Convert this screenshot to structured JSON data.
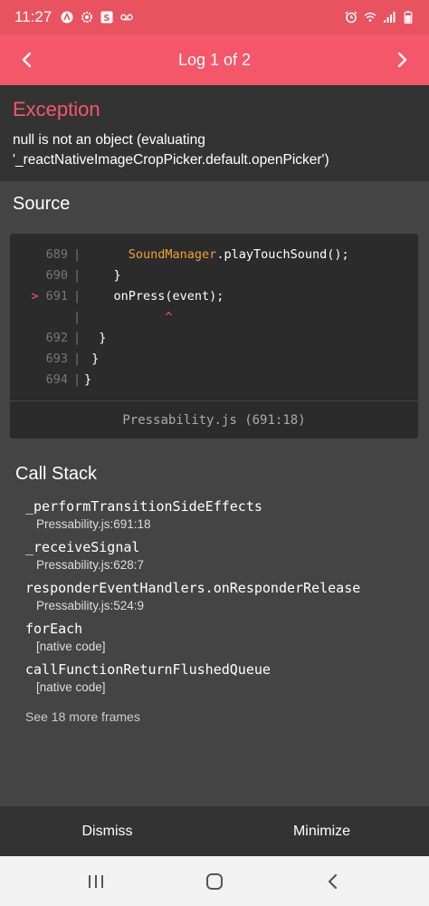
{
  "status_bar": {
    "time": "11:27",
    "left_icons": [
      "app-icon-a",
      "settings-cog-icon",
      "app-icon-s",
      "voicemail-icon"
    ],
    "right_icons": [
      "alarm-icon",
      "wifi-icon",
      "signal-icon",
      "battery-icon"
    ]
  },
  "header": {
    "title": "Log 1 of 2"
  },
  "exception": {
    "title": "Exception",
    "message": "null is not an object (evaluating '_reactNativeImageCropPicker.default.openPicker')"
  },
  "source": {
    "title": "Source",
    "lines": [
      {
        "num": "689",
        "marker": "",
        "pre": "      ",
        "hl": "SoundManager",
        "post": ".playTouchSound();"
      },
      {
        "num": "690",
        "marker": "",
        "pre": "    }",
        "hl": "",
        "post": ""
      },
      {
        "num": "691",
        "marker": ">",
        "pre": "    onPress(event);",
        "hl": "",
        "post": ""
      },
      {
        "num": "",
        "marker": "",
        "pre": "           ",
        "hl": "",
        "post": "",
        "caret": "^"
      },
      {
        "num": "692",
        "marker": "",
        "pre": "  }",
        "hl": "",
        "post": ""
      },
      {
        "num": "693",
        "marker": "",
        "pre": " }",
        "hl": "",
        "post": ""
      },
      {
        "num": "694",
        "marker": "",
        "pre": "}",
        "hl": "",
        "post": ""
      }
    ],
    "file_ref": "Pressability.js (691:18)"
  },
  "callstack": {
    "title": "Call Stack",
    "frames": [
      {
        "fn": "_performTransitionSideEffects",
        "file": "Pressability.js:691:18"
      },
      {
        "fn": "_receiveSignal",
        "file": "Pressability.js:628:7"
      },
      {
        "fn": "responderEventHandlers.onResponderRelease",
        "file": "Pressability.js:524:9"
      },
      {
        "fn": "forEach",
        "file": "[native code]"
      },
      {
        "fn": "callFunctionReturnFlushedQueue",
        "file": "[native code]"
      }
    ],
    "see_more": "See 18 more frames"
  },
  "bottom": {
    "dismiss": "Dismiss",
    "minimize": "Minimize"
  },
  "colors": {
    "accent": "#f4566a",
    "status_bar": "#e9525f",
    "background": "#444444",
    "panel": "#333333"
  }
}
